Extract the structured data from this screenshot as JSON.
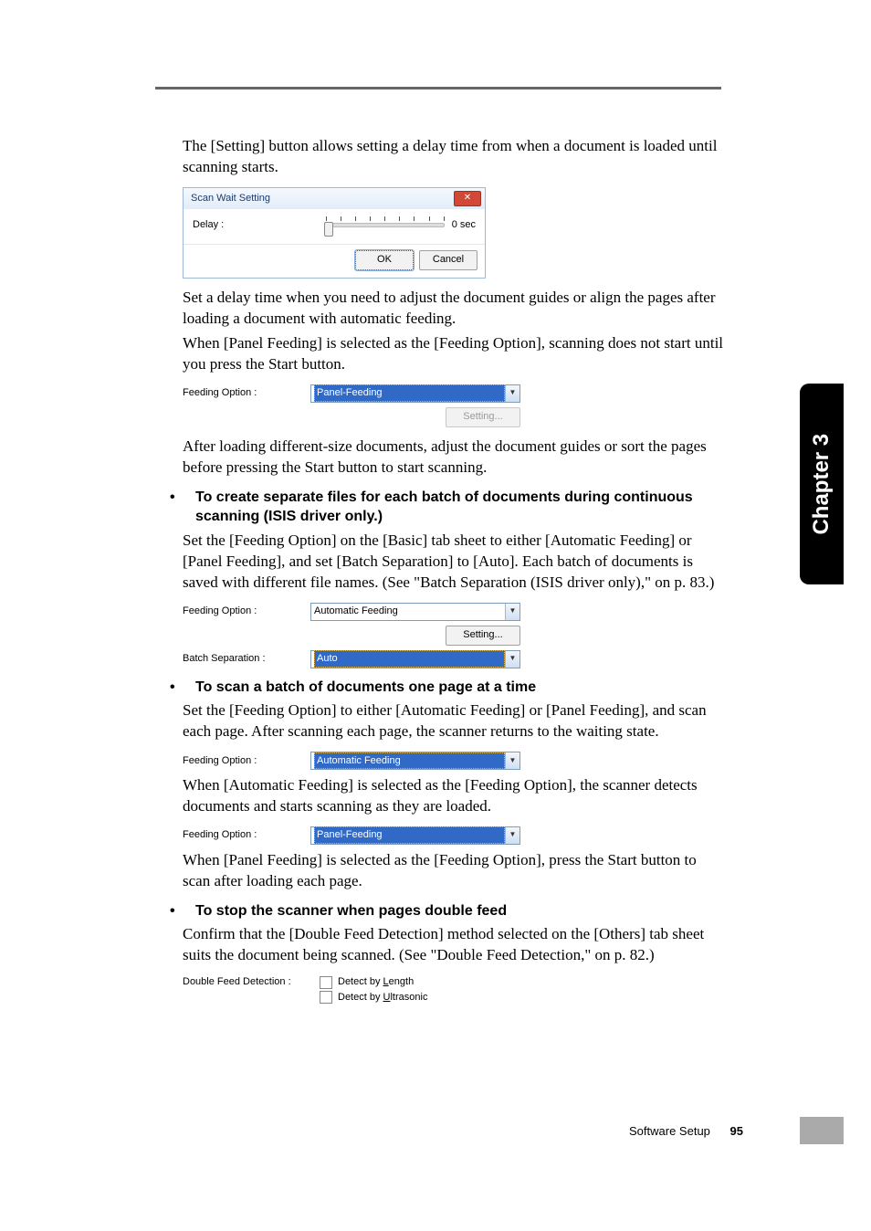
{
  "sideTab": "Chapter 3",
  "intro": "The [Setting] button allows setting a delay time from when a document is loaded until scanning starts.",
  "scanWait": {
    "title": "Scan Wait Setting",
    "delayLabel": "Delay :",
    "delayValue": "0 sec",
    "ok": "OK",
    "cancel": "Cancel"
  },
  "para2a": "Set a delay time when you need to adjust the document guides or align the pages after loading a document with automatic feeding.",
  "para2b": "When [Panel Feeding] is selected as the [Feeding Option], scanning does not start until you press the Start button.",
  "feedOpt1": {
    "label": "Feeding Option :",
    "value": "Panel-Feeding",
    "settingBtn": "Setting..."
  },
  "para3": "After loading different-size documents, adjust the document guides or sort the pages before pressing the Start button to start scanning.",
  "heading1": "To create separate files for each batch of documents during continuous scanning (ISIS driver only.)",
  "para4": "Set the [Feeding Option] on the [Basic] tab sheet to either [Automatic Feeding] or [Panel Feeding], and set [Batch Separation] to [Auto]. Each batch of documents is saved with different file names. (See \"Batch Separation (ISIS driver only),\" on p. 83.)",
  "feedOpt2": {
    "label": "Feeding Option :",
    "value": "Automatic Feeding",
    "settingBtn": "Setting...",
    "batchLabel": "Batch Separation :",
    "batchValue": "Auto"
  },
  "heading2": "To scan a batch of documents one page at a time",
  "para5": "Set the [Feeding Option] to either [Automatic Feeding] or [Panel Feeding], and scan each page. After scanning each page, the scanner returns to the waiting state.",
  "feedOpt3": {
    "label": "Feeding Option :",
    "value": "Automatic Feeding"
  },
  "para6": "When [Automatic Feeding] is selected as the [Feeding Option], the scanner detects documents and starts scanning as they are loaded.",
  "feedOpt4": {
    "label": "Feeding Option :",
    "value": "Panel-Feeding"
  },
  "para7": "When [Panel Feeding] is selected as the [Feeding Option], press the Start button to scan after loading each page.",
  "heading3": "To stop the scanner when pages double feed",
  "para8": "Confirm that the [Double Feed Detection] method selected on the [Others] tab sheet suits the document being scanned. (See \"Double Feed Detection,\" on p. 82.)",
  "doubleFeed": {
    "label": "Double Feed Detection :",
    "opt1_pre": "Detect by ",
    "opt1_u": "L",
    "opt1_post": "ength",
    "opt2_pre": "Detect by ",
    "opt2_u": "U",
    "opt2_post": "ltrasonic"
  },
  "footer": {
    "section": "Software Setup",
    "page": "95"
  }
}
